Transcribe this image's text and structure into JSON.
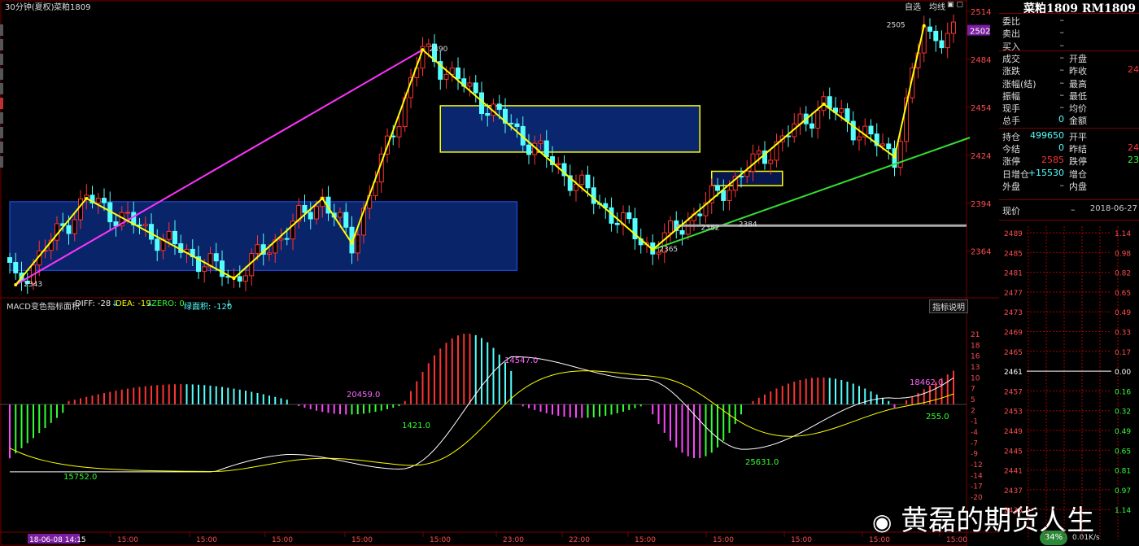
{
  "header": {
    "timeframe": "30分钟(夏权)",
    "symbol": "菜粕1809",
    "toolbar": [
      "自选",
      "均线"
    ],
    "macd_label": "MACD变色指标面积",
    "diff": "DIFF: -28",
    "dea": "DEA: -19",
    "zero": "ZERO: 0",
    "green_area": "绿面积: -120",
    "indicator_help": "指标说明"
  },
  "colors": {
    "up": "#ff3232",
    "down": "#54ffff",
    "macd_neg": "#ff44ff",
    "macd_neg_dark": "#33ff33",
    "yellow": "#ffff00",
    "magenta": "#ff33ff",
    "green_line": "#33dd33",
    "grid": "#7a0000",
    "box_fill": "#0b2a7a"
  },
  "chart_data": [
    {
      "type": "candlestick",
      "title": "菜粕1809",
      "ylim": [
        2343,
        2514
      ],
      "y_ticks": [
        2514,
        2484,
        2454,
        2424,
        2394,
        2364
      ],
      "current_price_marker": "2502",
      "point_labels": [
        "2343",
        "2490",
        "2365",
        "2382",
        "2384",
        "2505"
      ],
      "zigzag_points": [
        {
          "i": 1,
          "price": 2343
        },
        {
          "i": 13,
          "price": 2397
        },
        {
          "i": 38,
          "price": 2347
        },
        {
          "i": 53,
          "price": 2397
        },
        {
          "i": 58,
          "price": 2369
        },
        {
          "i": 70,
          "price": 2490
        },
        {
          "i": 109,
          "price": 2365
        },
        {
          "i": 138,
          "price": 2456
        },
        {
          "i": 150,
          "price": 2423
        },
        {
          "i": 155,
          "price": 2505
        }
      ],
      "magenta_line": [
        {
          "i": 1,
          "price": 2343
        },
        {
          "i": 70,
          "price": 2490
        }
      ],
      "consolidation_boxes": [
        {
          "i_start": 0,
          "i_end": 86,
          "price_low": 2352,
          "price_high": 2395
        },
        {
          "i_start": 73,
          "i_end": 117,
          "price_low": 2426,
          "price_high": 2455
        },
        {
          "i_start": 119,
          "i_end": 131,
          "price_low": 2405,
          "price_high": 2414
        }
      ],
      "trendline_green": [
        {
          "i": 109,
          "price": 2365
        },
        {
          "i": 160,
          "price": 2432
        }
      ],
      "support_line_gray": {
        "i_start": 113,
        "i_end": 160,
        "price": 2380
      },
      "x_ticks": [
        "18-06-08 14:15",
        "15:00",
        "15:00",
        "15:00",
        "15:00",
        "15:00",
        "23:00",
        "22:00",
        "15:00",
        "15:00",
        "15:00",
        "15:00",
        "15:00",
        "15:00"
      ]
    },
    {
      "type": "bar",
      "title": "MACD变色指标面积",
      "ylim": [
        -21,
        21
      ],
      "y_ticks": [
        "21",
        "18",
        "16",
        "13",
        "10",
        "7",
        "5",
        "2",
        "-1",
        "-4",
        "-7",
        "-9",
        "-12",
        "-14",
        "-17",
        "-20"
      ],
      "area_labels": [
        "15752.0",
        "20459.0",
        "1421.0",
        "14547.0",
        "25631.0",
        "18462.0",
        "255.0"
      ],
      "series": [
        {
          "name": "DIFF",
          "last": -28
        },
        {
          "name": "DEA",
          "last": -19
        }
      ]
    }
  ],
  "quote": {
    "title": "菜粕1809 RM1809",
    "rows": [
      {
        "n": "委比",
        "v": "–"
      },
      {
        "n": "卖出",
        "v": "–"
      },
      {
        "n": "买入",
        "v": "–"
      },
      {
        "n": "成交",
        "v": "–",
        "n2": "开盘",
        "v2": ""
      },
      {
        "n": "涨跌",
        "v": "–",
        "n2": "昨收",
        "v2": "24"
      },
      {
        "n": "涨幅(结)",
        "v": "–",
        "n2": "最高",
        "v2": ""
      },
      {
        "n": "振幅",
        "v": "–",
        "n2": "最低",
        "v2": ""
      },
      {
        "n": "现手",
        "v": "–",
        "n2": "均价",
        "v2": ""
      },
      {
        "n": "总手",
        "v": "0",
        "n2": "金额",
        "v2": ""
      },
      {
        "n": "持仓",
        "v": "499650",
        "n2": "开平",
        "v2": ""
      },
      {
        "n": "今结",
        "v": "0",
        "n2": "昨结",
        "v2": "24"
      },
      {
        "n": "涨停",
        "v": "2585",
        "n2": "跌停",
        "v2": "23"
      },
      {
        "n": "日增仓",
        "v": "+15530",
        "n2": "增仓",
        "v2": ""
      },
      {
        "n": "外盘",
        "v": "–",
        "n2": "内盘",
        "v2": ""
      }
    ],
    "now_label": "现价",
    "now_value": "–",
    "date": "2018-06-27",
    "ladder_prices": [
      "2489",
      "2485",
      "2481",
      "2477",
      "2473",
      "2469",
      "2465",
      "2461",
      "2457",
      "2453",
      "2449",
      "2445",
      "2441",
      "2437",
      "2433"
    ],
    "ladder_pct": [
      "1.14",
      "0.98",
      "0.82",
      "0.65",
      "0.49",
      "0.33",
      "0.17",
      "0.00",
      "0.16",
      "0.32",
      "0.49",
      "0.65",
      "0.81",
      "0.97",
      "1.14"
    ]
  },
  "watermark": "黄磊的期货人生",
  "status": {
    "badge": "34%",
    "speed": "0.01K/s"
  }
}
